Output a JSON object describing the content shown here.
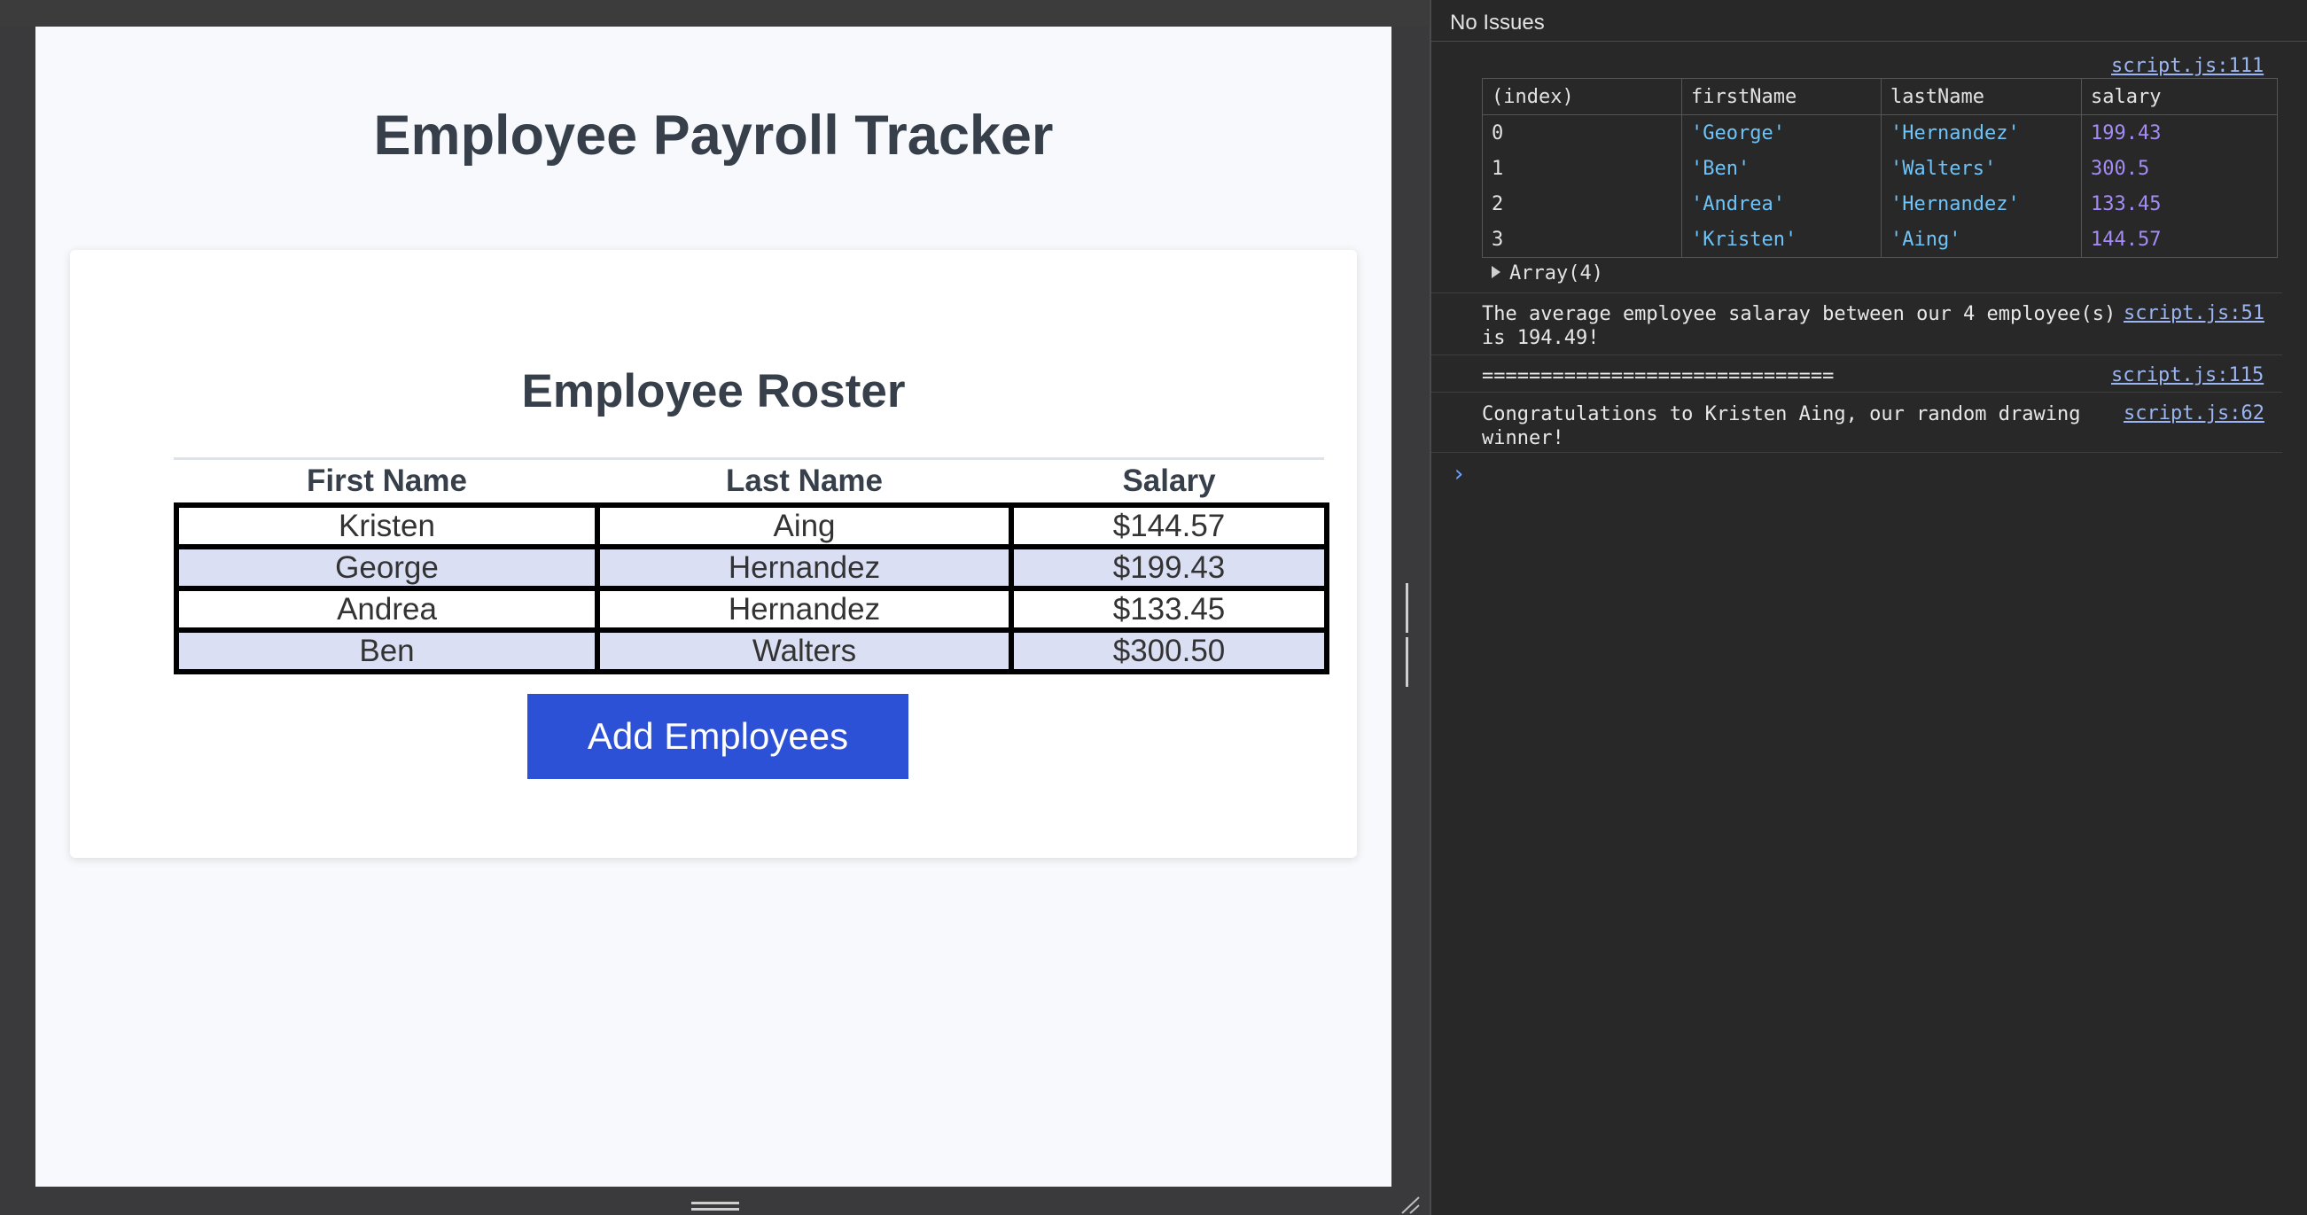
{
  "app": {
    "title": "Employee Payroll Tracker",
    "roster_title": "Employee Roster",
    "columns": [
      "First Name",
      "Last Name",
      "Salary"
    ],
    "rows": [
      {
        "first": "Kristen",
        "last": "Aing",
        "salary": "$144.57"
      },
      {
        "first": "George",
        "last": "Hernandez",
        "salary": "$199.43"
      },
      {
        "first": "Andrea",
        "last": "Hernandez",
        "salary": "$133.45"
      },
      {
        "first": "Ben",
        "last": "Walters",
        "salary": "$300.50"
      }
    ],
    "add_button_label": "Add Employees",
    "row_stripe_color": "#dadff4",
    "button_color": "#2c50d6"
  },
  "devtools": {
    "issues_label": "No Issues",
    "table_source": "script.js:111",
    "table_columns": [
      "(index)",
      "firstName",
      "lastName",
      "salary"
    ],
    "table_rows": [
      {
        "index": "0",
        "firstName": "'George'",
        "lastName": "'Hernandez'",
        "salary": "199.43"
      },
      {
        "index": "1",
        "firstName": "'Ben'",
        "lastName": "'Walters'",
        "salary": "300.5"
      },
      {
        "index": "2",
        "firstName": "'Andrea'",
        "lastName": "'Hernandez'",
        "salary": "133.45"
      },
      {
        "index": "3",
        "firstName": "'Kristen'",
        "lastName": "'Aing'",
        "salary": "144.57"
      }
    ],
    "array_label": "Array(4)",
    "average_message_line1": "The average employee salaray between our 4 employee(s)",
    "average_message_line2": "is 194.49!",
    "average_source": "script.js:51",
    "separator_message": "==============================",
    "separator_source": "script.js:115",
    "winner_message_line1": "Congratulations to Kristen Aing, our random drawing",
    "winner_message_line2": "winner!",
    "winner_source": "script.js:62",
    "prompt_symbol": "›"
  }
}
